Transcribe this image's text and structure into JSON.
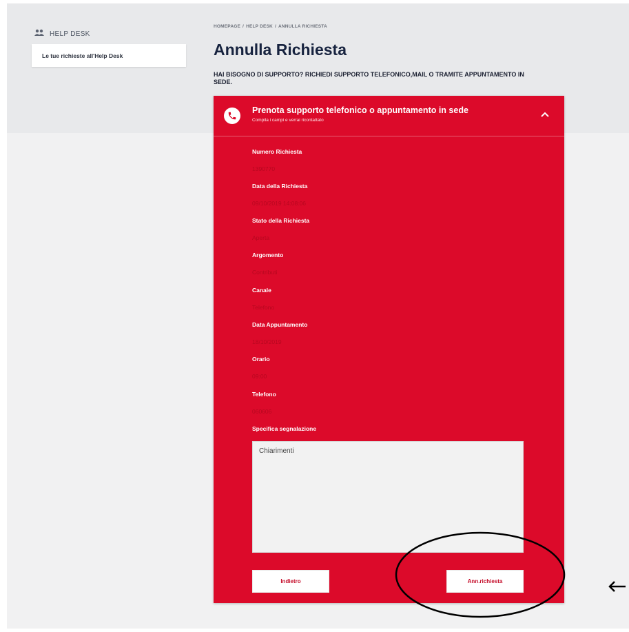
{
  "sidebar": {
    "title": "HELP DESK",
    "icon": "users-icon",
    "link_label": "Le tue richieste all'Help Desk"
  },
  "breadcrumb": [
    "HOMEPAGE",
    "HELP DESK",
    "ANNULLA RICHIESTA"
  ],
  "page": {
    "title": "Annulla Richiesta",
    "support_text": "HAI BISOGNO DI SUPPORTO? RICHIEDI SUPPORTO TELEFONICO,MAIL O TRAMITE APPUNTAMENTO IN SEDE."
  },
  "panel": {
    "title": "Prenota supporto telefonico o appuntamento in sede",
    "subtitle": "Compila i campi e verrai ricontattato",
    "accent_color": "#dc0a2a",
    "fields": [
      {
        "label": "Numero Richiesta",
        "value": "1390770"
      },
      {
        "label": "Data della Richiesta",
        "value": "09/10/2019 14:08:06"
      },
      {
        "label": "Stato della Richiesta",
        "value": "Aperta"
      },
      {
        "label": "Argomento",
        "value": "Contributi"
      },
      {
        "label": "Canale",
        "value": "Telefono"
      },
      {
        "label": "Data Appuntamento",
        "value": "18/10/2019"
      },
      {
        "label": "Orario",
        "value": "09:00"
      },
      {
        "label": "Telefono",
        "value": "060606"
      }
    ],
    "notes_label": "Specifica segnalazione",
    "notes_value": "Chiarimenti",
    "back_label": "Indietro",
    "cancel_label": "Ann.richiesta"
  }
}
